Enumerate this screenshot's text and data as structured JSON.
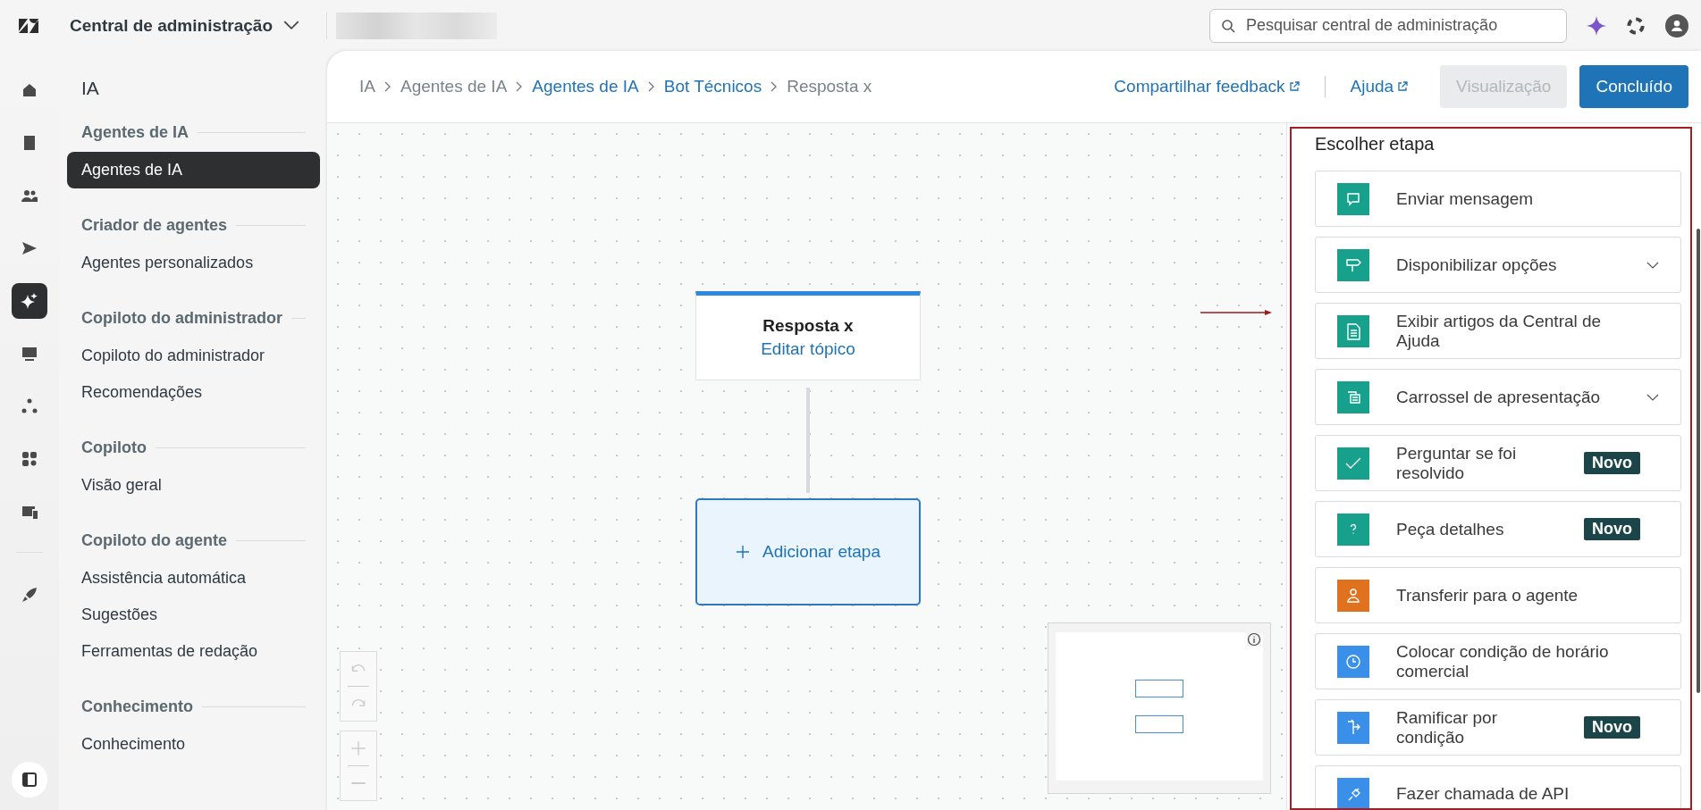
{
  "topbar": {
    "product": "Central de administração",
    "search": {
      "placeholder": "Pesquisar central de administração"
    }
  },
  "rail": [
    {
      "selected": false
    },
    {
      "selected": false
    },
    {
      "selected": false
    },
    {
      "selected": false
    },
    {
      "selected": true
    },
    {
      "selected": false
    },
    {
      "selected": false
    },
    {
      "selected": false
    },
    {
      "selected": false
    },
    {
      "selected": false
    }
  ],
  "sidebar": {
    "title": "IA",
    "sections": [
      {
        "title": "Agentes de IA",
        "items": [
          {
            "label": "Agentes de IA",
            "selected": true
          }
        ]
      },
      {
        "title": "Criador de agentes",
        "items": [
          {
            "label": "Agentes personalizados",
            "selected": false
          }
        ]
      },
      {
        "title": "Copiloto do administrador",
        "items": [
          {
            "label": "Copiloto do administrador",
            "selected": false
          },
          {
            "label": "Recomendações",
            "selected": false
          }
        ]
      },
      {
        "title": "Copiloto",
        "items": [
          {
            "label": "Visão geral",
            "selected": false
          }
        ]
      },
      {
        "title": "Copiloto do agente",
        "items": [
          {
            "label": "Assistência automática",
            "selected": false
          },
          {
            "label": "Sugestões",
            "selected": false
          },
          {
            "label": "Ferramentas de redação",
            "selected": false
          }
        ]
      },
      {
        "title": "Conhecimento",
        "items": [
          {
            "label": "Conhecimento",
            "selected": false
          }
        ]
      }
    ]
  },
  "breadcrumb": [
    {
      "label": "IA",
      "link": false
    },
    {
      "label": "Agentes de IA",
      "link": false
    },
    {
      "label": "Agentes de IA",
      "link": true
    },
    {
      "label": "Bot Técnicos",
      "link": true
    },
    {
      "label": "Resposta x",
      "link": false
    }
  ],
  "header_links": [
    "Compartilhar feedback",
    "Ajuda"
  ],
  "buttons": [
    {
      "label": "Visualização",
      "disabled": true
    },
    {
      "label": "Concluído",
      "disabled": false
    }
  ],
  "canvas": {
    "node": {
      "title": "Resposta x",
      "link": "Editar tópico"
    },
    "add_step": "Adicionar etapa"
  },
  "panel": {
    "title": "Escolher etapa",
    "steps": [
      {
        "label": "Enviar mensagem",
        "color": "#17a08b",
        "expandable": false
      },
      {
        "label": "Disponibilizar opções",
        "color": "#17a08b",
        "expandable": true
      },
      {
        "label": "Exibir artigos da Central de Ajuda",
        "color": "#17a08b",
        "expandable": false
      },
      {
        "label": "Carrossel de apresentação",
        "color": "#17a08b",
        "expandable": true
      },
      {
        "label": "Perguntar se foi resolvido",
        "color": "#17a08b",
        "expandable": false,
        "badge": "Novo"
      },
      {
        "label": "Peça detalhes",
        "color": "#17a08b",
        "expandable": false,
        "badge": "Novo"
      },
      {
        "label": "Transferir para o agente",
        "color": "#e0711f",
        "expandable": false
      },
      {
        "label": "Colocar condição de horário comercial",
        "color": "#3a8fe8",
        "expandable": false
      },
      {
        "label": "Ramificar por condição",
        "color": "#3a8fe8",
        "expandable": false,
        "badge": "Novo"
      },
      {
        "label": "Fazer chamada de API",
        "color": "#3a8fe8",
        "expandable": false
      }
    ]
  }
}
